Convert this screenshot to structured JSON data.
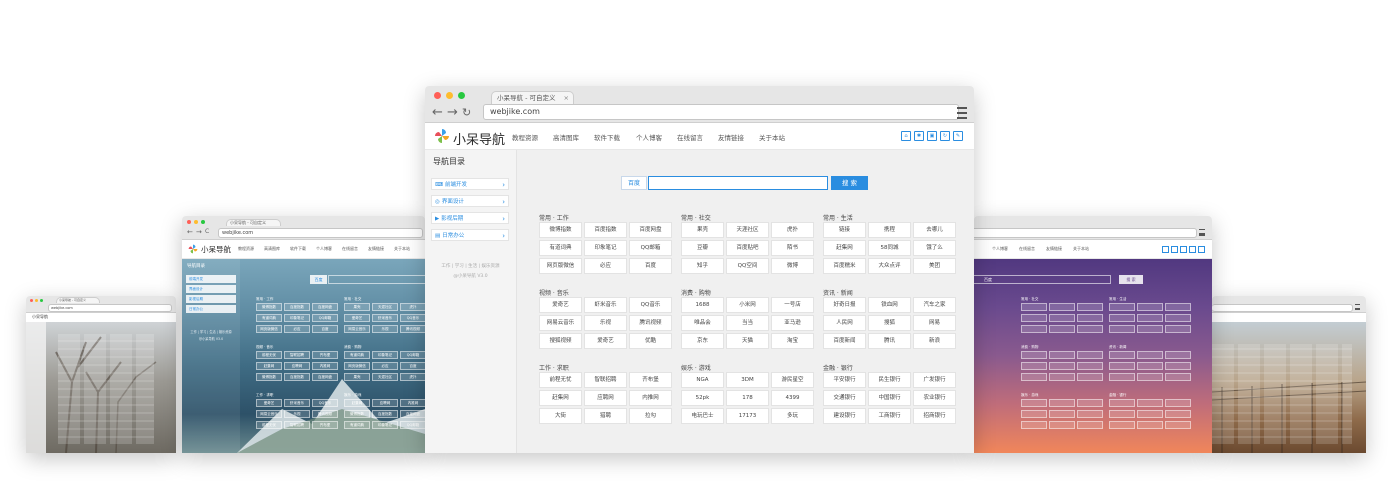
{
  "main_window": {
    "tab_title": "小呆导航 - 可自定义",
    "tab_close": "×",
    "address": "webjike.com",
    "brand": "小呆导航",
    "menu": [
      "教程资源",
      "高清图库",
      "软件下载",
      "个人博客",
      "在线留言",
      "友情链接",
      "关于本站"
    ],
    "toolbar_icons": [
      "home-icon",
      "gear-icon",
      "image-icon",
      "refresh-icon",
      "edit-icon"
    ],
    "sidebar": {
      "title": "导航目录",
      "items": [
        "前端开发",
        "界面设计",
        "影视后期",
        "日常办公"
      ],
      "footer_line1": "工作 | 学习 | 生活 | 娱乐资源",
      "footer_line2": "@小呆导航 V3.0"
    },
    "search": {
      "engine": "百度",
      "button": "搜 索"
    },
    "groups": [
      {
        "title": "常用 · 工作",
        "cells": [
          "微博指数",
          "百度指数",
          "百度网盘",
          "有道词典",
          "印象笔记",
          "QQ邮箱",
          "网页版微信",
          "必应",
          "百度"
        ]
      },
      {
        "title": "常用 · 社交",
        "cells": [
          "果壳",
          "天涯社区",
          "虎扑",
          "豆瓣",
          "百度贴吧",
          "陌书",
          "知乎",
          "QQ空间",
          "微博"
        ]
      },
      {
        "title": "常用 · 生活",
        "cells": [
          "链接",
          "携程",
          "去哪儿",
          "赶集网",
          "58同城",
          "饿了么",
          "百度糯米",
          "大众点评",
          "美团"
        ]
      },
      {
        "title": "视频 · 音乐",
        "cells": [
          "爱奇艺",
          "虾米音乐",
          "QQ音乐",
          "网易云音乐",
          "乐视",
          "腾讯视频",
          "搜狐视频",
          "爱奇艺",
          "优酷"
        ]
      },
      {
        "title": "消费 · 购物",
        "cells": [
          "1688",
          "小米网",
          "一号店",
          "唯品会",
          "当当",
          "亚马逊",
          "京东",
          "天猫",
          "淘宝"
        ]
      },
      {
        "title": "资讯 · 新闻",
        "cells": [
          "好奇日报",
          "铁血网",
          "汽车之家",
          "人民网",
          "搜狐",
          "网易",
          "百度新闻",
          "腾讯",
          "新浪"
        ]
      },
      {
        "title": "工作 · 求职",
        "cells": [
          "前程无忧",
          "智联招聘",
          "齐布堡",
          "赶集网",
          "应聘网",
          "内推网",
          "大街",
          "猎聘",
          "拉勾"
        ]
      },
      {
        "title": "娱乐 · 游戏",
        "cells": [
          "NGA",
          "3DM",
          "游民星空",
          "52pk",
          "178",
          "4399",
          "电玩巴士",
          "17173",
          "多玩"
        ]
      },
      {
        "title": "金融 · 银行",
        "cells": [
          "平安银行",
          "民生银行",
          "广发银行",
          "交通银行",
          "中国银行",
          "农业银行",
          "建设银行",
          "工商银行",
          "招商银行"
        ]
      }
    ]
  },
  "left_window": {
    "tab_title": "小呆导航 - 可自定义",
    "address": "webjike.com",
    "brand": "小呆导航",
    "menu": [
      "教程资源",
      "高清图库",
      "软件下载",
      "个人博客",
      "在线留言",
      "友情链接",
      "关于本站"
    ],
    "sidebar_title": "导航目录",
    "sidebar_items": [
      "前端开发",
      "界面设计",
      "影视后期",
      "日常办公"
    ],
    "footer_line1": "工作 | 学习 | 生活 | 娱乐资源",
    "footer_line2": "@小呆导航 V3.0",
    "search_engine": "百度",
    "group_titles": [
      "常用 · 工作",
      "常用 · 社交",
      "视频 · 音乐",
      "消费 · 购物",
      "工作 · 求职",
      "娱乐 · 游戏"
    ],
    "cells": [
      "微博指数",
      "百度指数",
      "百度网盘",
      "有道词典",
      "印象笔记",
      "QQ邮箱",
      "网页版微信",
      "必应",
      "百度",
      "果壳",
      "天涯社区",
      "虎扑",
      "爱奇艺",
      "虾米音乐",
      "QQ音乐",
      "网易云音乐",
      "乐视",
      "腾讯视频",
      "前程无忧",
      "智联招聘",
      "齐布堡",
      "赶集网",
      "应聘网",
      "内推网"
    ]
  },
  "right_window": {
    "menu": [
      "个人博客",
      "在线留言",
      "友情链接",
      "关于本站"
    ],
    "search_engine": "百度",
    "search_button": "搜 索",
    "group_titles": [
      "常用 · 社交",
      "常用 · 生活",
      "消费 · 购物",
      "资讯 · 新闻",
      "娱乐 · 游戏",
      "金融 · 银行"
    ]
  },
  "far_left_window": {
    "tab_title": "小呆导航 - 可自定义",
    "address": "webjike.com",
    "brand": "小呆导航"
  },
  "colors": {
    "accent": "#2a8de0",
    "left_photo_top": "#6f9bb3",
    "right_photo_top": "#5b3d88",
    "right_photo_bottom": "#f0865a"
  }
}
